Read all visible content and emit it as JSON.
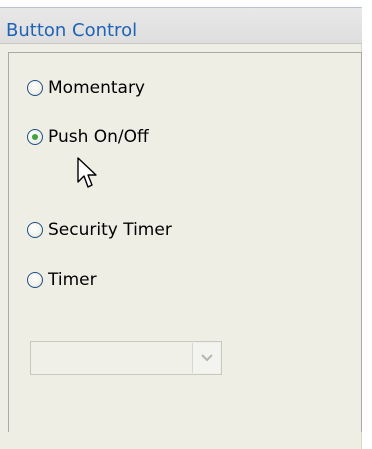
{
  "header": {
    "title": "Button Control"
  },
  "radio_options": [
    {
      "label": "Momentary",
      "checked": false
    },
    {
      "label": "Push On/Off",
      "checked": true
    },
    {
      "label": "Security Timer",
      "checked": false
    },
    {
      "label": "Timer",
      "checked": false
    }
  ],
  "dropdown": {
    "selected_value": "",
    "enabled": false
  },
  "icons": {
    "cursor": "arrow-pointer-icon",
    "dropdown": "chevron-down-icon"
  },
  "colors": {
    "title_text": "#1f63b5",
    "panel_bg": "#efeee5",
    "radio_checked": "#3fa33f"
  }
}
